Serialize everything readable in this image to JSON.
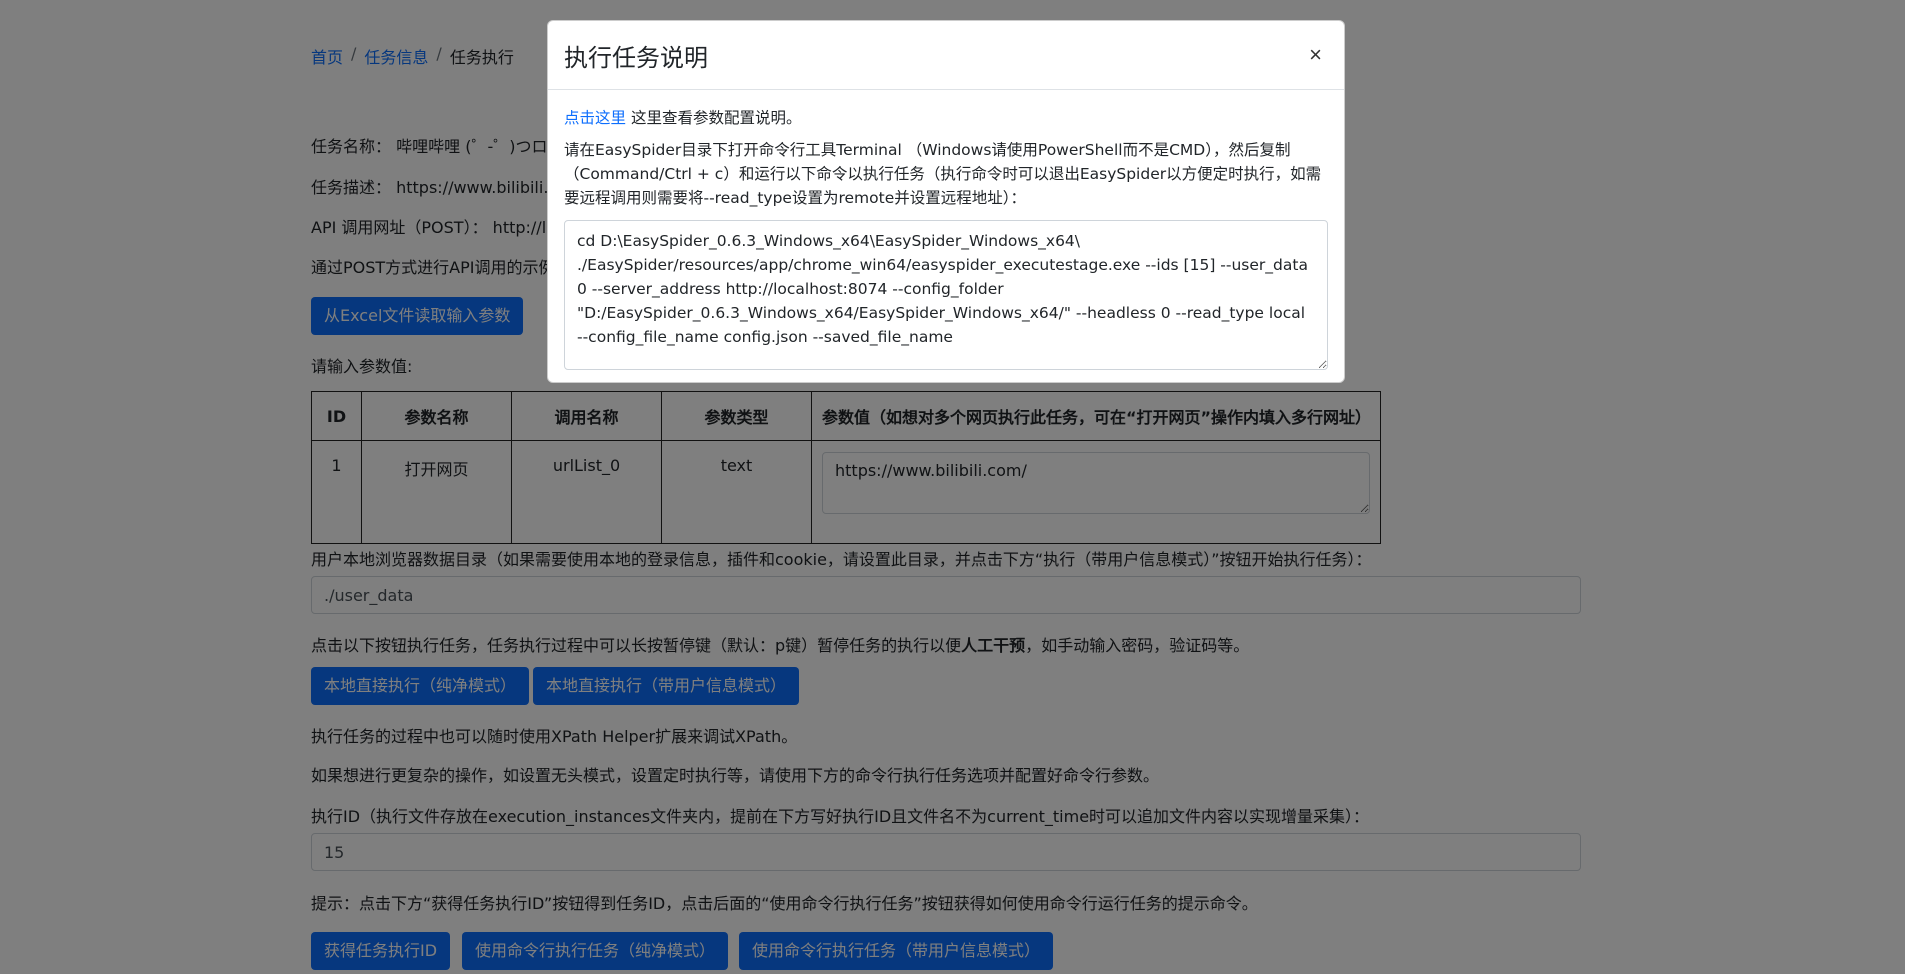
{
  "breadcrumb": {
    "home": "首页",
    "task_info": "任务信息",
    "current": "任务执行"
  },
  "task": {
    "name_label": "任务名称：",
    "name_value": "哔哩哔哩 (゜-゜)つロ",
    "desc_label": "任务描述：",
    "desc_value": "https://www.bilibili.co",
    "api_label": "API 调用网址（POST）：",
    "api_value": "http://lo",
    "post_example": "通过POST方式进行API调用的示例"
  },
  "excel_button": "从Excel文件读取输入参数",
  "param_prompt": "请输入参数值:",
  "table": {
    "headers": [
      "ID",
      "参数名称",
      "调用名称",
      "参数类型",
      "参数值（如想对多个网页执行此任务，可在“打开网页”操作内填入多行网址）"
    ],
    "rows": [
      {
        "id": "1",
        "name": "打开网页",
        "call_name": "urlList_0",
        "type": "text",
        "value": "https://www.bilibili.com/"
      }
    ]
  },
  "user_data": {
    "label": "用户本地浏览器数据目录（如果需要使用本地的登录信息，插件和cookie，请设置此目录，并点击下方“执行（带用户信息模式）”按钮开始执行任务）：",
    "value": "./user_data"
  },
  "exec_hint_before": "点击以下按钮执行任务，任务执行过程中可以长按暂停键（默认：p键）暂停任务的执行以便",
  "exec_hint_bold": "人工干预",
  "exec_hint_after": "，如手动输入密码，验证码等。",
  "buttons": {
    "run_clean": "本地直接执行（纯净模式）",
    "run_user": "本地直接执行（带用户信息模式）",
    "get_id": "获得任务执行ID",
    "cmd_clean": "使用命令行执行任务（纯净模式）",
    "cmd_user": "使用命令行执行任务（带用户信息模式）"
  },
  "xpath_hint": "执行任务的过程中也可以随时使用XPath Helper扩展来调试XPath。",
  "advanced_hint": "如果想进行更复杂的操作，如设置无头模式，设置定时执行等，请使用下方的命令行执行任务选项并配置好命令行参数。",
  "exec_id": {
    "label": "执行ID（执行文件存放在execution_instances文件夹内，提前在下方写好执行ID且文件名不为current_time时可以追加文件内容以实现增量采集）：",
    "value": "15"
  },
  "tip": "提示：点击下方“获得任务执行ID”按钮得到任务ID，点击后面的“使用命令行执行任务”按钮获得如何使用命令行运行任务的提示命令。",
  "modal": {
    "title": "执行任务说明",
    "close": "×",
    "link_text": "点击这里",
    "link_suffix": " 这里查看参数配置说明。",
    "instruction": "请在EasySpider目录下打开命令行工具Terminal （Windows请使用PowerShell而不是CMD），然后复制（Command/Ctrl + c）和运行以下命令以执行任务（执行命令时可以退出EasySpider以方便定时执行，如需要远程调用则需要将--read_type设置为remote并设置远程地址）：",
    "command": "cd D:\\EasySpider_0.6.3_Windows_x64\\EasySpider_Windows_x64\\\n./EasySpider/resources/app/chrome_win64/easyspider_executestage.exe --ids [15] --user_data 0 --server_address http://localhost:8074 --config_folder \"D:/EasySpider_0.6.3_Windows_x64/EasySpider_Windows_x64/\" --headless 0 --read_type local --config_file_name config.json --saved_file_name"
  }
}
